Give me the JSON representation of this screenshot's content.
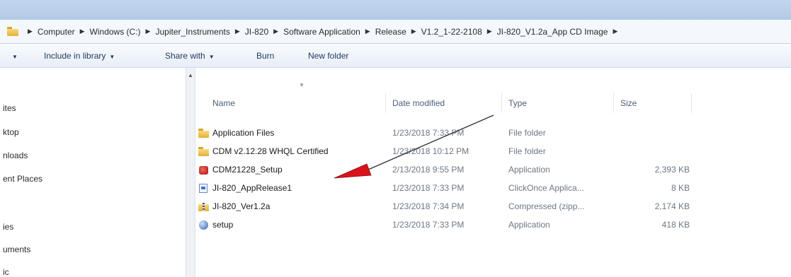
{
  "address_bar": {
    "crumbs": [
      "Computer",
      "Windows (C:)",
      "Jupiter_Instruments",
      "JI-820",
      "Software Application",
      "Release",
      "V1.2_1-22-2108",
      "JI-820_V1.2a_App CD Image"
    ]
  },
  "command_bar": {
    "include_in_library": "Include in library",
    "share_with": "Share with",
    "burn": "Burn",
    "new_folder": "New folder"
  },
  "nav_pane": {
    "items": [
      "ites",
      "ktop",
      "nloads",
      "ent Places",
      "ies",
      "uments",
      "ic"
    ]
  },
  "columns": {
    "name": "Name",
    "date_modified": "Date modified",
    "type": "Type",
    "size": "Size"
  },
  "files": [
    {
      "name": "Application Files",
      "date": "1/23/2018 7:33 PM",
      "type": "File folder",
      "size": "",
      "icon": "folder-icon"
    },
    {
      "name": "CDM v2.12.28 WHQL Certified",
      "date": "1/23/2018 10:12 PM",
      "type": "File folder",
      "size": "",
      "icon": "folder-icon"
    },
    {
      "name": "CDM21228_Setup",
      "date": "2/13/2018 9:55 PM",
      "type": "Application",
      "size": "2,393 KB",
      "icon": "setup-app-icon"
    },
    {
      "name": "JI-820_AppRelease1",
      "date": "1/23/2018 7:33 PM",
      "type": "ClickOnce Applica...",
      "size": "8 KB",
      "icon": "clickonce-manifest-icon"
    },
    {
      "name": "JI-820_Ver1.2a",
      "date": "1/23/2018 7:34 PM",
      "type": "Compressed (zipp...",
      "size": "2,174 KB",
      "icon": "zip-folder-icon"
    },
    {
      "name": "setup",
      "date": "1/23/2018 7:33 PM",
      "type": "Application",
      "size": "418 KB",
      "icon": "setup-globe-icon"
    }
  ],
  "colors": {
    "title_strip": "#b3c9e6",
    "address_bar_bg": "#f4f8fc",
    "command_text": "#1e395b",
    "annotation_arrow": "#d8141a"
  }
}
